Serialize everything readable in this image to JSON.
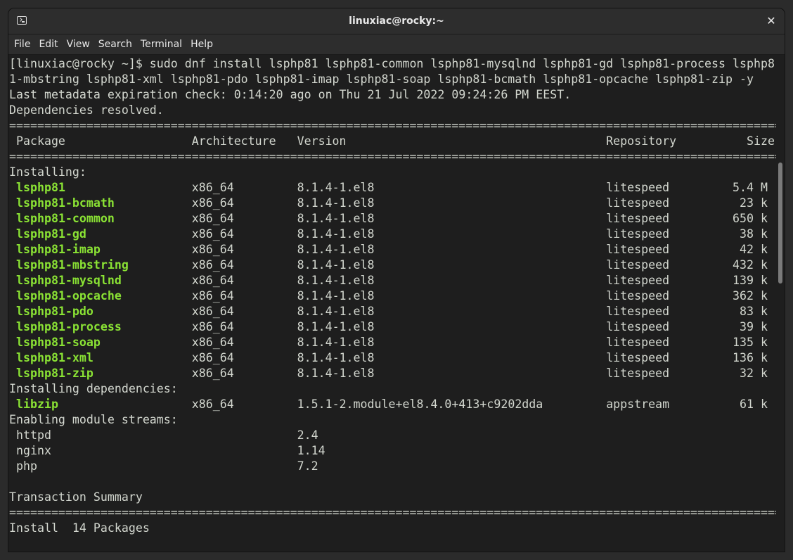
{
  "window": {
    "title": "linuxiac@rocky:~"
  },
  "menu": [
    "File",
    "Edit",
    "View",
    "Search",
    "Terminal",
    "Help"
  ],
  "terminal": {
    "command_line_1": "[linuxiac@rocky ~]$ sudo dnf install lsphp81 lsphp81-common lsphp81-mysqlnd lsphp81-gd lsphp81-process lsphp8",
    "command_line_2": "1-mbstring lsphp81-xml lsphp81-pdo lsphp81-imap lsphp81-soap lsphp81-bcmath lsphp81-opcache lsphp81-zip -y",
    "metadata_line": "Last metadata expiration check: 0:14:20 ago on Thu 21 Jul 2022 09:24:26 PM EEST.",
    "deps_resolved": "Dependencies resolved.",
    "separator": "================================================================================================================",
    "headers": {
      "package": "Package",
      "arch": "Architecture",
      "version": "Version",
      "repo": "Repository",
      "size": "Size"
    },
    "installing_label": "Installing:",
    "installing": [
      {
        "name": "lsphp81",
        "arch": "x86_64",
        "version": "8.1.4-1.el8",
        "repo": "litespeed",
        "size": "5.4 M"
      },
      {
        "name": "lsphp81-bcmath",
        "arch": "x86_64",
        "version": "8.1.4-1.el8",
        "repo": "litespeed",
        "size": "23 k"
      },
      {
        "name": "lsphp81-common",
        "arch": "x86_64",
        "version": "8.1.4-1.el8",
        "repo": "litespeed",
        "size": "650 k"
      },
      {
        "name": "lsphp81-gd",
        "arch": "x86_64",
        "version": "8.1.4-1.el8",
        "repo": "litespeed",
        "size": "38 k"
      },
      {
        "name": "lsphp81-imap",
        "arch": "x86_64",
        "version": "8.1.4-1.el8",
        "repo": "litespeed",
        "size": "42 k"
      },
      {
        "name": "lsphp81-mbstring",
        "arch": "x86_64",
        "version": "8.1.4-1.el8",
        "repo": "litespeed",
        "size": "432 k"
      },
      {
        "name": "lsphp81-mysqlnd",
        "arch": "x86_64",
        "version": "8.1.4-1.el8",
        "repo": "litespeed",
        "size": "139 k"
      },
      {
        "name": "lsphp81-opcache",
        "arch": "x86_64",
        "version": "8.1.4-1.el8",
        "repo": "litespeed",
        "size": "362 k"
      },
      {
        "name": "lsphp81-pdo",
        "arch": "x86_64",
        "version": "8.1.4-1.el8",
        "repo": "litespeed",
        "size": "83 k"
      },
      {
        "name": "lsphp81-process",
        "arch": "x86_64",
        "version": "8.1.4-1.el8",
        "repo": "litespeed",
        "size": "39 k"
      },
      {
        "name": "lsphp81-soap",
        "arch": "x86_64",
        "version": "8.1.4-1.el8",
        "repo": "litespeed",
        "size": "135 k"
      },
      {
        "name": "lsphp81-xml",
        "arch": "x86_64",
        "version": "8.1.4-1.el8",
        "repo": "litespeed",
        "size": "136 k"
      },
      {
        "name": "lsphp81-zip",
        "arch": "x86_64",
        "version": "8.1.4-1.el8",
        "repo": "litespeed",
        "size": "32 k"
      }
    ],
    "deps_label": "Installing dependencies:",
    "dependencies": [
      {
        "name": "libzip",
        "arch": "x86_64",
        "version": "1.5.1-2.module+el8.4.0+413+c9202dda",
        "repo": "appstream",
        "size": "61 k"
      }
    ],
    "streams_label": "Enabling module streams:",
    "streams": [
      {
        "name": "httpd",
        "version": "2.4"
      },
      {
        "name": "nginx",
        "version": "1.14"
      },
      {
        "name": "php",
        "version": "7.2"
      }
    ],
    "summary_label": "Transaction Summary",
    "install_summary": "Install  14 Packages"
  },
  "colors": {
    "package_name": "#8ae234",
    "text": "#d3d7cf",
    "background": "#1e1e1e"
  }
}
